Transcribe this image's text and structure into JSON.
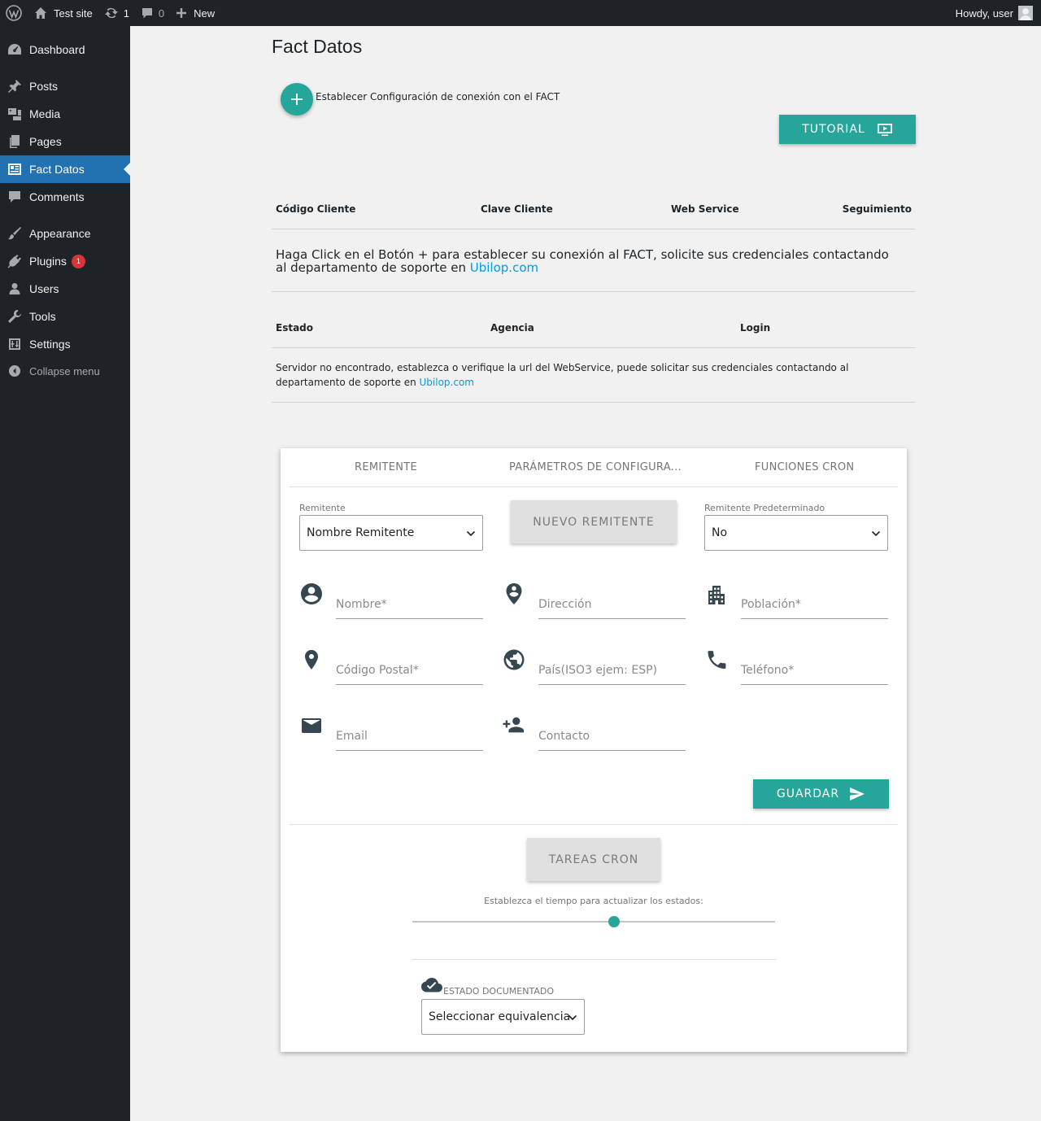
{
  "adminbar": {
    "site_name": "Test site",
    "updates_count": "1",
    "comments_count": "0",
    "new_label": "New",
    "howdy": "Howdy, user"
  },
  "sidebar": {
    "items": [
      {
        "label": "Dashboard",
        "icon": "dashboard-icon"
      },
      {
        "label": "Posts",
        "icon": "pin-icon"
      },
      {
        "label": "Media",
        "icon": "media-icon"
      },
      {
        "label": "Pages",
        "icon": "pages-icon"
      },
      {
        "label": "Fact Datos",
        "icon": "id-card-icon",
        "current": true
      },
      {
        "label": "Comments",
        "icon": "comment-icon"
      },
      {
        "label": "Appearance",
        "icon": "brush-icon"
      },
      {
        "label": "Plugins",
        "icon": "plugin-icon",
        "badge": "1"
      },
      {
        "label": "Users",
        "icon": "user-icon"
      },
      {
        "label": "Tools",
        "icon": "wrench-icon"
      },
      {
        "label": "Settings",
        "icon": "settings-icon"
      }
    ],
    "collapse_label": "Collapse menu"
  },
  "page": {
    "title": "Fact Datos",
    "add_connection_label": "Establecer Configuración de conexión con el FACT",
    "tutorial_label": "TUTORIAL"
  },
  "table1": {
    "headers": [
      "Código Cliente",
      "Clave Cliente",
      "Web Service",
      "Seguimiento"
    ],
    "message": "Haga Click en el Botón + para establecer su conexión al FACT, solicite sus credenciales contactando al departamento de soporte en ",
    "link": "Ubilop.com"
  },
  "table2": {
    "headers": [
      "Estado",
      "Agencia",
      "Login"
    ],
    "message": "Servidor no encontrado, establezca o verifique la url del WebService, puede solicitar sus credenciales contactando al departamento de soporte en ",
    "link": "Ubilop.com"
  },
  "card": {
    "tabs": [
      "REMITENTE",
      "PARÁMETROS DE CONFIGURA...",
      "FUNCIONES CRON"
    ],
    "remitente_label": "Remitente",
    "remitente_value": "Nombre Remitente",
    "nuevo_remitente_label": "NUEVO REMITENTE",
    "predeterminado_label": "Remitente Predeterminado",
    "predeterminado_value": "No",
    "fields": {
      "nombre": "Nombre*",
      "direccion": "Dirección",
      "poblacion": "Población*",
      "codigo_postal": "Código Postal*",
      "pais": "País(ISO3 ejem: ESP)",
      "telefono": "Teléfono*",
      "email": "Email",
      "contacto": "Contacto"
    },
    "guardar_label": "GUARDAR",
    "tareas_cron_label": "TAREAS CRON",
    "slider_label": "Establezca el tiempo para actualizar los estados:",
    "slider_fraction": 0.555,
    "estado_label": "ESTADO DOCUMENTADO",
    "estado_value": "Seleccionar equivalencia"
  },
  "colors": {
    "accent": "#26a69a",
    "admin_dark": "#1d2327",
    "menu_current": "#2271b1",
    "link": "#039be5"
  }
}
